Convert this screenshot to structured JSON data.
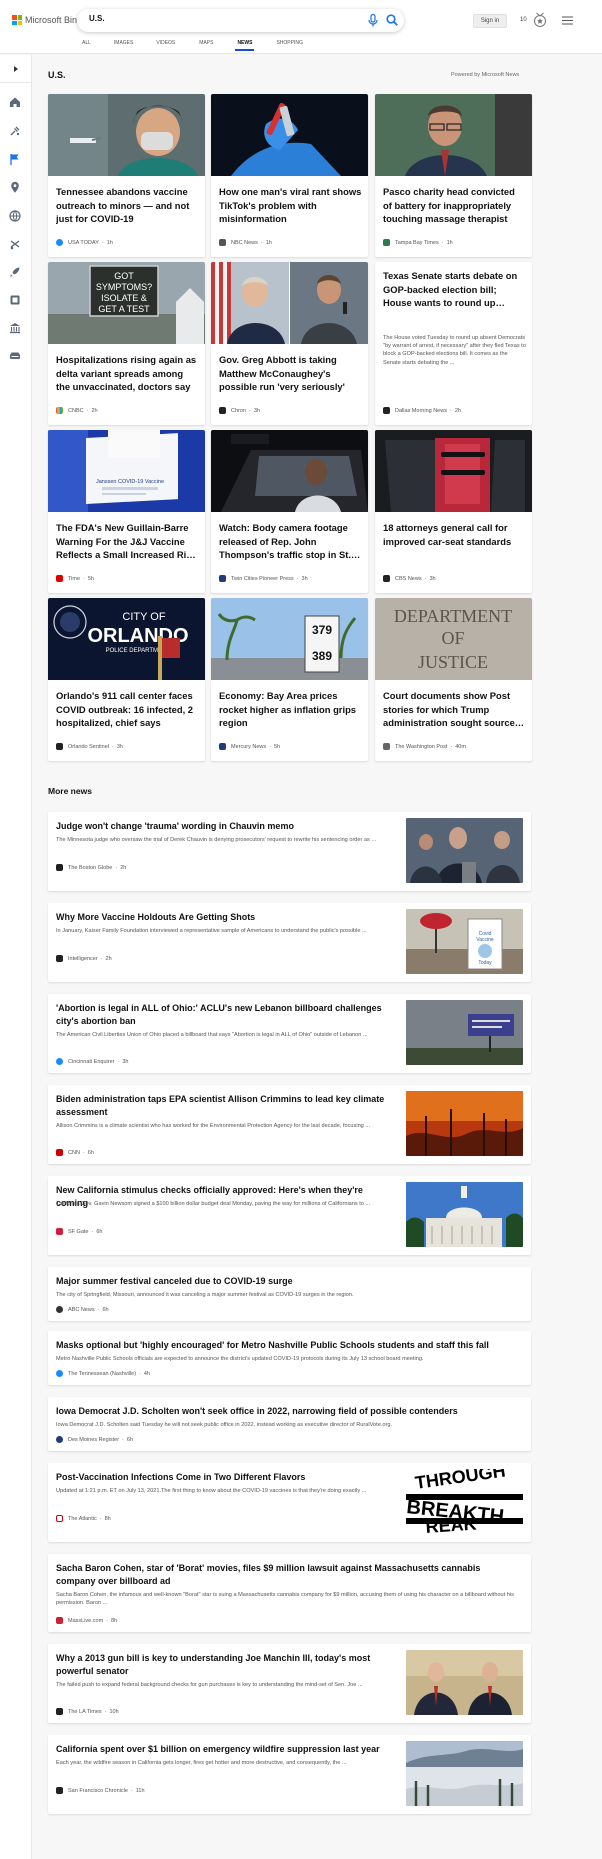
{
  "header": {
    "brand": "Microsoft Bing",
    "search_value": "U.S.",
    "sign_in": "Sign in",
    "rewards_count": "10",
    "nav": [
      {
        "label": "ALL",
        "active": false
      },
      {
        "label": "IMAGES",
        "active": false
      },
      {
        "label": "VIDEOS",
        "active": false
      },
      {
        "label": "MAPS",
        "active": false
      },
      {
        "label": "NEWS",
        "active": true
      },
      {
        "label": "SHOPPING",
        "active": false
      }
    ]
  },
  "sidebar": {
    "icons": [
      "chevron-right-icon",
      "home-icon",
      "tools-icon",
      "flag-icon",
      "location-icon",
      "globe-icon",
      "sports-icon",
      "rocket-icon",
      "entertainment-icon",
      "bank-icon",
      "car-icon"
    ]
  },
  "section": {
    "title": "U.S.",
    "powered_by": "Powered by Microsoft News"
  },
  "cards": [
    {
      "title": "Tennessee abandons vaccine outreach to minors — and not just for COVID-19",
      "source": "USA TODAY",
      "time": "1h",
      "logo_color": "#1a8cff"
    },
    {
      "title": "How one man's viral rant shows TikTok's problem with misinformation",
      "source": "NBC News",
      "time": "1h",
      "logo_color": "#555555"
    },
    {
      "title": "Pasco charity head convicted of battery for inappropriately touching massage therapist",
      "source": "Tampa Bay Times",
      "time": "1h",
      "logo_color": "#2a7a4b"
    },
    {
      "title": "Hospitalizations rising again as delta variant spreads among the unvaccinated, doctors say",
      "source": "CNBC",
      "time": "2h",
      "logo_color": "#e24a3b"
    },
    {
      "title": "Gov. Greg Abbott is taking Matthew McConaughey's possible run 'very seriously'",
      "source": "Chron",
      "time": "3h",
      "logo_color": "#222222"
    },
    {
      "title": "Texas Senate starts debate on GOP-backed election bill; House wants to round up…",
      "snippet": "The House voted Tuesday to round up absent Democrats \"by warrant of arrest, if necessary\" after they fled Texas to block a GOP-backed elections bill. It comes as the Senate starts debating the ...",
      "source": "Dallas Morning News",
      "time": "2h",
      "logo_color": "#222222"
    },
    {
      "title": "The FDA's New Guillain-Barre Warning For the J&J Vaccine Reflects a Small Increased Ri…",
      "source": "Time",
      "time": "5h",
      "logo_color": "#e00000"
    },
    {
      "title": "Watch: Body camera footage released of Rep. John Thompson's traffic stop in St.…",
      "source": "Twin Cities Pioneer Press",
      "time": "3h",
      "logo_color": "#1f3d7a"
    },
    {
      "title": "18 attorneys general call for improved car-seat standards",
      "source": "CBS News",
      "time": "3h",
      "logo_color": "#222222"
    },
    {
      "title": "Orlando's 911 call center faces COVID outbreak: 16 infected, 2 hospitalized, chief says",
      "source": "Orlando Sentinel",
      "time": "3h",
      "logo_color": "#222222"
    },
    {
      "title": "Economy: Bay Area prices rocket higher as inflation grips region",
      "source": "Mercury News",
      "time": "5h",
      "logo_color": "#1f3d7a"
    },
    {
      "title": "Court documents show Post stories for which Trump administration sought source…",
      "source": "The Washington Post",
      "time": "40m",
      "logo_color": "#666666"
    }
  ],
  "more_news_title": "More news",
  "more_news": [
    {
      "title": "Judge won't change 'trauma' wording in Chauvin memo",
      "snippet": "The Minnesota judge who oversaw the trial of Derek Chauvin is denying prosecutors' request to rewrite his sentencing order as ...",
      "source": "The Boston Globe",
      "time": "2h",
      "logo_color": "#222222"
    },
    {
      "title": "Why More Vaccine Holdouts Are Getting Shots",
      "snippet": "In January, Kaiser Family Foundation interviewed a representative sample of Americans to understand the public's possible ...",
      "source": "Intelligencer",
      "time": "2h",
      "logo_color": "#222222"
    },
    {
      "title": "'Abortion is legal in ALL of Ohio:' ACLU's new Lebanon billboard challenges city's abortion ban",
      "snippet": "The American Civil Liberties Union of Ohio placed a billboard that says \"Abortion is legal in ALL of Ohio\" outside of Lebanon ...",
      "source": "Cincinnati Enquirer",
      "time": "3h",
      "logo_color": "#1a8cff"
    },
    {
      "title": "Biden administration taps EPA scientist Allison Crimmins to lead key climate assessment",
      "snippet": "Allison Crimmins is a climate scientist who has worked for the Environmental Protection Agency for the last decade, focusing ...",
      "source": "CNN",
      "time": "6h",
      "logo_color": "#cc0000"
    },
    {
      "title": "New California stimulus checks officially approved: Here's when they're coming",
      "snippet": "California Gov. Gavin Newsom signed a $100 billion dollar budget deal Monday, paving the way for millions of Californians to ...",
      "source": "SF Gate",
      "time": "6h",
      "logo_color": "#d41f3c"
    },
    {
      "title": "Major summer festival canceled due to COVID-19 surge",
      "snippet": "The city of Springfield, Missouri, announced it was canceling a major summer festival as COVID-19 surges in the region.",
      "source": "ABC News",
      "time": "6h",
      "logo_color": "#333333"
    },
    {
      "title": "Masks optional but 'highly encouraged' for Metro Nashville Public Schools students and staff this fall",
      "snippet": "Metro Nashville Public Schools officials are expected to announce the district's updated COVID-19 protocols during its July 13 school board meeting.",
      "source": "The Tennessean (Nashville)",
      "time": "4h",
      "logo_color": "#1a8cff"
    },
    {
      "title": "Iowa Democrat J.D. Scholten won't seek office in 2022, narrowing field of possible contenders",
      "snippet": "Iowa Democrat J.D. Scholten said Tuesday he will not seek public office in 2022, instead working as executive director of RuralVote.org.",
      "source": "Des Moines Register",
      "time": "6h",
      "logo_color": "#1f3d7a"
    },
    {
      "title": "Post-Vaccination Infections Come in Two Different Flavors",
      "snippet": "Updated at 1:21 p.m. ET on July 13, 2021.The first thing to know about the COVID-19 vaccines is that they're doing exactly ...",
      "source": "The Atlantic",
      "time": "8h",
      "logo_color": "#d0021b"
    },
    {
      "title": "Sacha Baron Cohen, star of 'Borat' movies, files $9 million lawsuit against Massachusetts cannabis company over billboard ad",
      "snippet": "Sacha Baron Cohen, the infamous and well-known \"Borat\" star is suing a Massachusetts cannabis company for $9 million, accusing them of using his character on a billboard without his permission. Baron ...",
      "source": "MassLive.com",
      "time": "8h",
      "logo_color": "#cc2233"
    },
    {
      "title": "Why a 2013 gun bill is key to understanding Joe Manchin III, today's most powerful senator",
      "snippet": "The failed push to expand federal background checks for gun purchases is key to understanding the mind-set of Sen. Joe ...",
      "source": "The LA Times",
      "time": "10h",
      "logo_color": "#222222"
    },
    {
      "title": "California spent over $1 billion on emergency wildfire suppression last year",
      "snippet": "Each year, the wildfire season in California gets longer, fires get hotter and more destructive, and consequently, the ...",
      "source": "San Francisco Chronicle",
      "time": "11h",
      "logo_color": "#222222"
    }
  ]
}
